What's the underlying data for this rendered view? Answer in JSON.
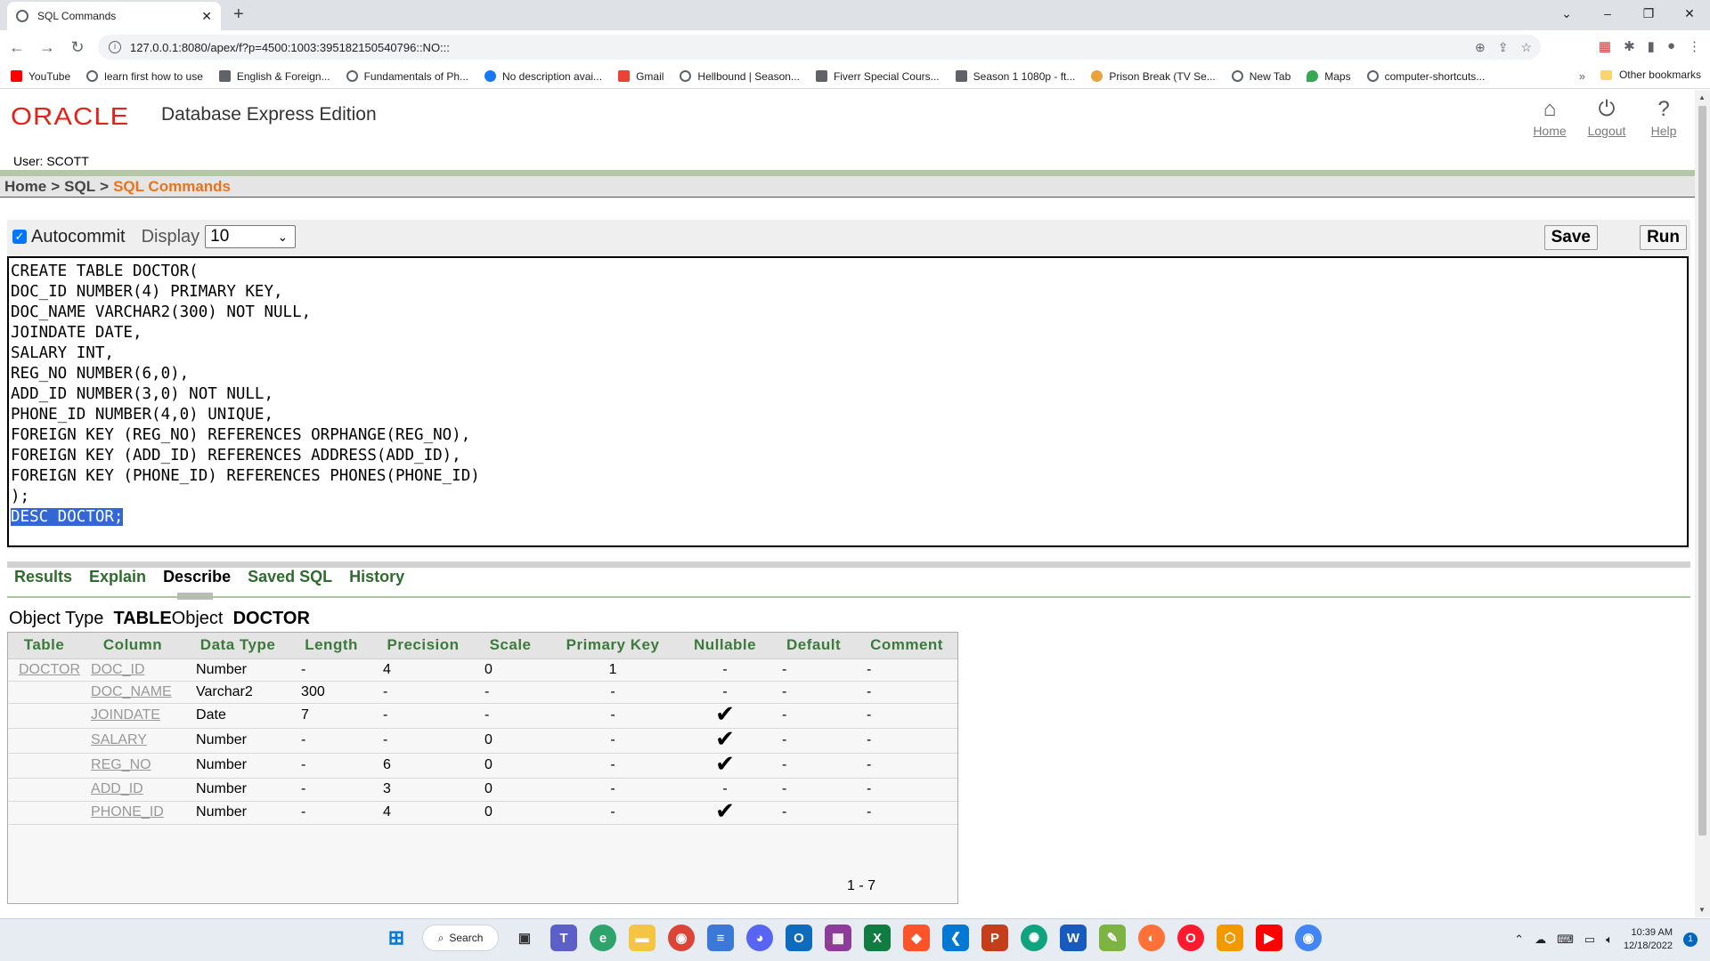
{
  "browser": {
    "tab_title": "SQL Commands",
    "url": "127.0.0.1:8080/apex/f?p=4500:1003:395182150540796::NO:::",
    "bookmarks": [
      {
        "label": "YouTube",
        "color": "#ff0000"
      },
      {
        "label": "learn first how to use",
        "color": "#5f6368"
      },
      {
        "label": "English & Foreign...",
        "color": "#5f6368"
      },
      {
        "label": "Fundamentals of Ph...",
        "color": "#5f6368"
      },
      {
        "label": "No description avai...",
        "color": "#1877f2"
      },
      {
        "label": "Gmail",
        "color": "#ea4335"
      },
      {
        "label": "Hellbound | Season...",
        "color": "#5f6368"
      },
      {
        "label": "Fiverr Special Cours...",
        "color": "#5f6368"
      },
      {
        "label": "Season 1 1080p - ft...",
        "color": "#5f6368"
      },
      {
        "label": "Prison Break (TV Se...",
        "color": "#e8a33d"
      },
      {
        "label": "New Tab",
        "color": "#5f6368"
      },
      {
        "label": "Maps",
        "color": "#34a853"
      },
      {
        "label": "computer-shortcuts...",
        "color": "#5f6368"
      }
    ],
    "other_bookmarks": "Other bookmarks"
  },
  "header": {
    "logo_text": "ORACLE",
    "product": "Database Express Edition",
    "user": "User: SCOTT",
    "links": {
      "home": "Home",
      "logout": "Logout",
      "help": "Help"
    }
  },
  "breadcrumb": {
    "home": "Home",
    "sql": "SQL",
    "current": "SQL Commands",
    "sep": ">"
  },
  "commands": {
    "autocommit_label": "Autocommit",
    "autocommit_checked": true,
    "display_label": "Display",
    "display_value": "10",
    "save_label": "Save",
    "run_label": "Run",
    "sql_text": "CREATE TABLE DOCTOR(\nDOC_ID NUMBER(4) PRIMARY KEY,\nDOC_NAME VARCHAR2(300) NOT NULL,\nJOINDATE DATE,\nSALARY INT,\nREG_NO NUMBER(6,0),\nADD_ID NUMBER(3,0) NOT NULL,\nPHONE_ID NUMBER(4,0) UNIQUE,\nFOREIGN KEY (REG_NO) REFERENCES ORPHANGE(REG_NO),\nFOREIGN KEY (ADD_ID) REFERENCES ADDRESS(ADD_ID),\nFOREIGN KEY (PHONE_ID) REFERENCES PHONES(PHONE_ID)\n);\n",
    "selected_text": "DESC DOCTOR;"
  },
  "result_tabs": [
    {
      "label": "Results",
      "active": false
    },
    {
      "label": "Explain",
      "active": false
    },
    {
      "label": "Describe",
      "active": true
    },
    {
      "label": "Saved SQL",
      "active": false
    },
    {
      "label": "History",
      "active": false
    }
  ],
  "describe": {
    "object_type_label": "Object Type",
    "object_type": "TABLE",
    "object_label": "Object",
    "object_name": "DOCTOR",
    "columns": [
      "Table",
      "Column",
      "Data Type",
      "Length",
      "Precision",
      "Scale",
      "Primary Key",
      "Nullable",
      "Default",
      "Comment"
    ],
    "rows": [
      {
        "table": "DOCTOR",
        "column": "DOC_ID",
        "type": "Number",
        "length": "-",
        "precision": "4",
        "scale": "0",
        "pk": "1",
        "nullable": false,
        "default": "-",
        "comment": "-"
      },
      {
        "table": "",
        "column": "DOC_NAME",
        "type": "Varchar2",
        "length": "300",
        "precision": "-",
        "scale": "-",
        "pk": "-",
        "nullable": false,
        "default": "-",
        "comment": "-"
      },
      {
        "table": "",
        "column": "JOINDATE",
        "type": "Date",
        "length": "7",
        "precision": "-",
        "scale": "-",
        "pk": "-",
        "nullable": true,
        "default": "-",
        "comment": "-"
      },
      {
        "table": "",
        "column": "SALARY",
        "type": "Number",
        "length": "-",
        "precision": "-",
        "scale": "0",
        "pk": "-",
        "nullable": true,
        "default": "-",
        "comment": "-"
      },
      {
        "table": "",
        "column": "REG_NO",
        "type": "Number",
        "length": "-",
        "precision": "6",
        "scale": "0",
        "pk": "-",
        "nullable": true,
        "default": "-",
        "comment": "-"
      },
      {
        "table": "",
        "column": "ADD_ID",
        "type": "Number",
        "length": "-",
        "precision": "3",
        "scale": "0",
        "pk": "-",
        "nullable": false,
        "default": "-",
        "comment": "-"
      },
      {
        "table": "",
        "column": "PHONE_ID",
        "type": "Number",
        "length": "-",
        "precision": "4",
        "scale": "0",
        "pk": "-",
        "nullable": true,
        "default": "-",
        "comment": "-"
      }
    ],
    "not_null_mark": "-",
    "pagination": "1 - 7"
  },
  "taskbar": {
    "search_label": "Search",
    "time": "10:39 AM",
    "date": "12/18/2022",
    "notification_count": "1"
  }
}
